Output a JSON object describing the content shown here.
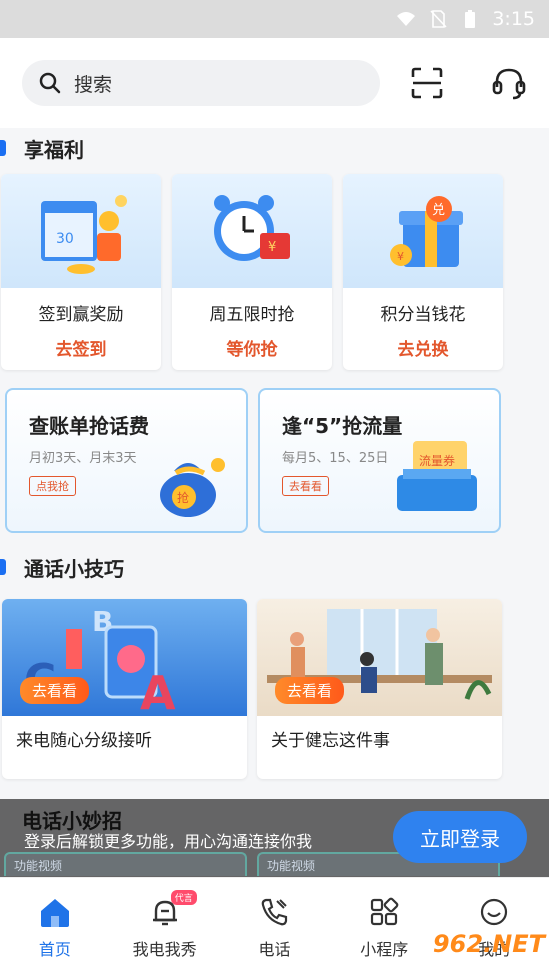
{
  "status": {
    "time": "3:15"
  },
  "search": {
    "placeholder": "搜索"
  },
  "section_benefits": {
    "title": "享福利"
  },
  "benefits": [
    {
      "title": "签到赢奖励",
      "action": "去签到"
    },
    {
      "title": "周五限时抢",
      "action": "等你抢"
    },
    {
      "title": "积分当钱花",
      "action": "去兑换"
    }
  ],
  "promos": [
    {
      "title": "查账单抢话费",
      "sub": "月初3天、月末3天",
      "button": "点我抢",
      "img_text": "抢"
    },
    {
      "title": "逢“5”抢流量",
      "sub": "每月5、15、25日",
      "button": "去看看",
      "img_text": "流量券"
    }
  ],
  "section_tips": {
    "title": "通话小技巧"
  },
  "tips": [
    {
      "label": "来电随心分级接听",
      "go": "去看看"
    },
    {
      "label": "关于健忘这件事",
      "go": "去看看"
    }
  ],
  "overlay": {
    "section_title": "电话小妙招",
    "text": "登录后解锁更多功能，用心沟通连接你我",
    "login_button": "立即登录",
    "tags": [
      "功能视频",
      "功能视频"
    ]
  },
  "tabs": [
    {
      "label": "首页",
      "icon": "home-icon",
      "active": true
    },
    {
      "label": "我电我秀",
      "icon": "bell-icon",
      "badge": "代言"
    },
    {
      "label": "电话",
      "icon": "phone-icon"
    },
    {
      "label": "小程序",
      "icon": "apps-icon"
    },
    {
      "label": "我的",
      "icon": "smile-icon"
    }
  ],
  "watermark": "962.NET",
  "colors": {
    "accent": "#1f73e8",
    "action": "#e3572d",
    "login": "#2f82ef"
  }
}
